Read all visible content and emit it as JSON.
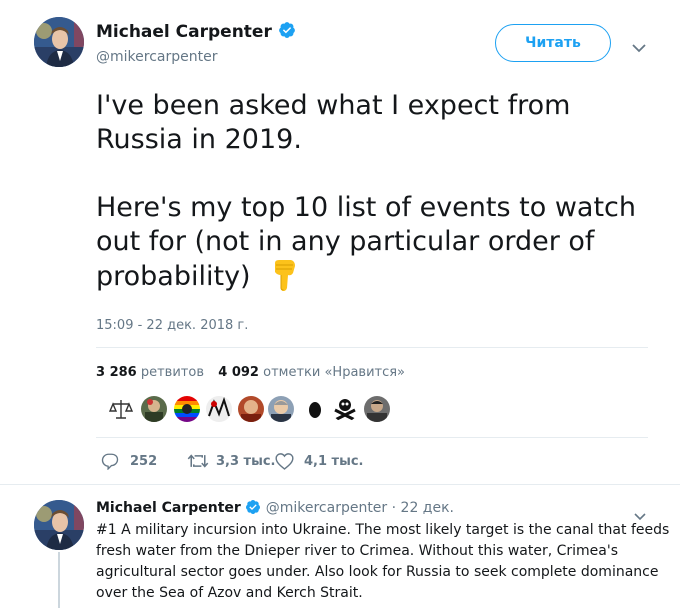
{
  "tweet": {
    "author_name": "Michael Carpenter",
    "author_handle": "@mikercarpenter",
    "follow_label": "Читать",
    "text_line1": "I've been asked what I expect from",
    "text_line2": "Russia in 2019.",
    "text_line3": "Here's my top 10 list of events to watch",
    "text_line4": "out for (not in any particular order of",
    "text_line5": "probability)",
    "emoji": "👇",
    "timestamp": "15:09 - 22 дек. 2018 г.",
    "retweets_count": "3 286",
    "retweets_label": "ретвитов",
    "likes_count": "4 092",
    "likes_label": "отметки «Нравится»",
    "reply_count": "252",
    "retweet_action_count": "3,3 тыс.",
    "like_action_count": "4,1 тыс."
  },
  "reply": {
    "author_name": "Michael Carpenter",
    "author_handle": "@mikercarpenter",
    "date": "· 22 дек.",
    "line1": "#1 A military incursion into Ukraine. The most likely target is the canal that feeds",
    "line2": "fresh water from the Dnieper river to Crimea. Without this water, Crimea's",
    "line3": "agricultural sector goes under. Also look for Russia to seek complete dominance",
    "line4": "over the Sea of Azov and Kerch Strait."
  },
  "colors": {
    "accent": "#1da1f2",
    "secondary_text": "#657786",
    "divider": "#e6ecf0"
  },
  "icons": [
    "verified-badge-icon",
    "chevron-down-icon",
    "reply-icon",
    "retweet-icon",
    "heart-icon",
    "pointing-down-emoji"
  ]
}
